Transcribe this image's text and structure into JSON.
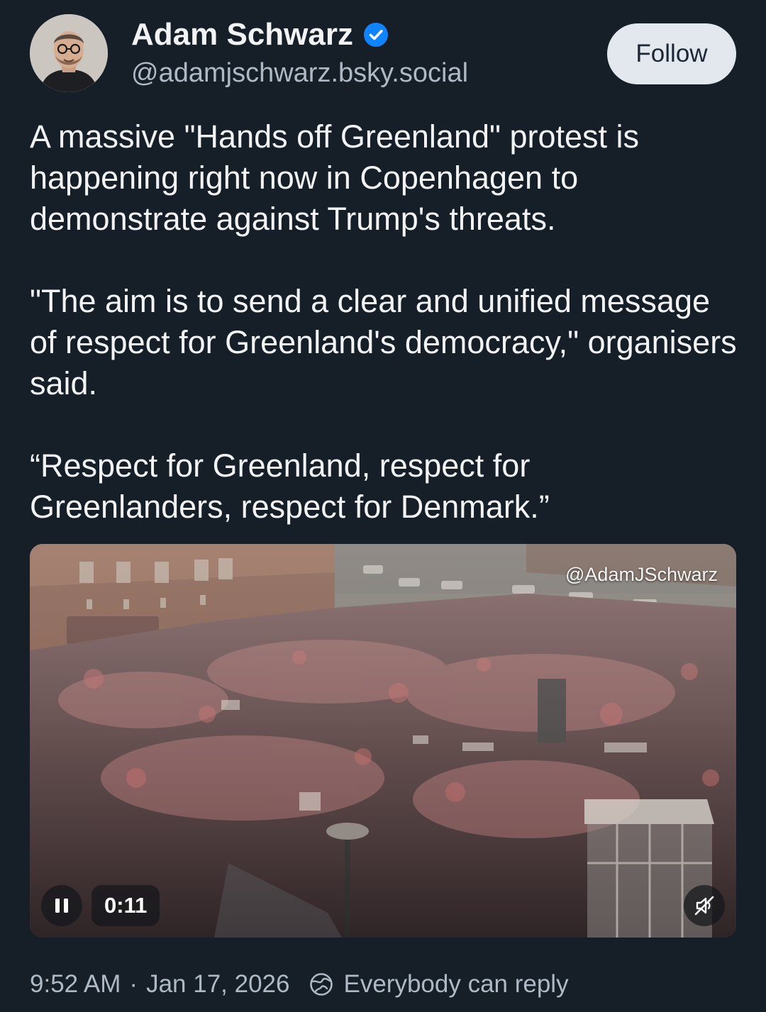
{
  "author": {
    "display_name": "Adam Schwarz",
    "handle": "@adamjschwarz.bsky.social",
    "verified": true
  },
  "follow_button": {
    "label": "Follow"
  },
  "post": {
    "paragraphs": [
      "A massive \"Hands off Greenland\" protest is happening right now in Copenhagen to demonstrate against Trump's threats.",
      "\"The aim is to send a clear and unified message of respect for Greenland's democracy,\" organisers said.",
      "“Respect for Greenland, respect for Greenlanders, respect for Denmark.”"
    ]
  },
  "video": {
    "watermark": "@AdamJSchwarz",
    "elapsed": "0:11",
    "playing": true,
    "muted": true
  },
  "meta": {
    "time": "9:52 AM",
    "separator": "·",
    "date": "Jan 17, 2026",
    "reply_setting": "Everybody can reply"
  },
  "colors": {
    "background": "#161e27",
    "text": "#f1f3f5",
    "muted_text": "#aeb9c6",
    "verified_badge": "#1083fe",
    "follow_button_bg": "#e3e7ee"
  },
  "icons": {
    "verified": "verified-check-icon",
    "pause": "pause-icon",
    "mute": "speaker-muted-icon",
    "reply_setting": "globe-icon"
  }
}
